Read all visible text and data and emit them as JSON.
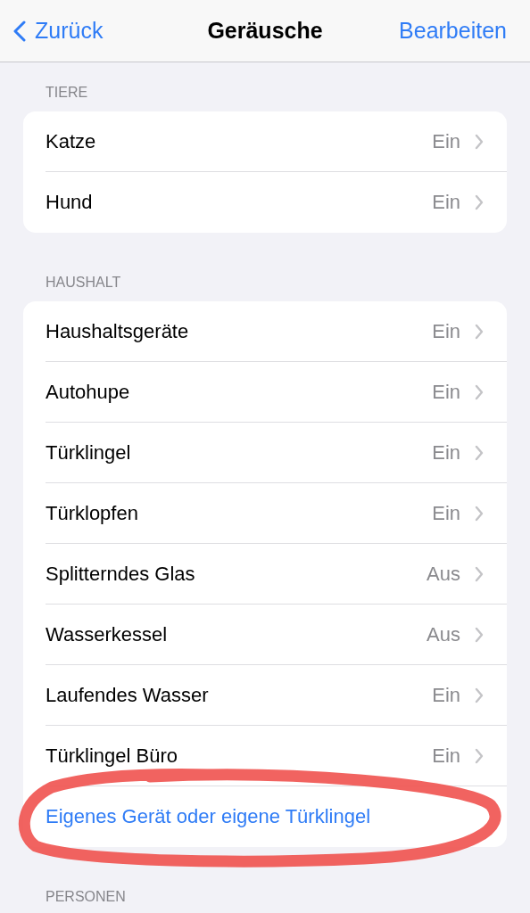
{
  "nav": {
    "back": "Zurück",
    "title": "Geräusche",
    "action": "Bearbeiten"
  },
  "sections": [
    {
      "header": "TIERE",
      "rows": [
        {
          "kind": "item",
          "label": "Katze",
          "value": "Ein"
        },
        {
          "kind": "item",
          "label": "Hund",
          "value": "Ein"
        }
      ]
    },
    {
      "header": "HAUSHALT",
      "rows": [
        {
          "kind": "item",
          "label": "Haushaltsgeräte",
          "value": "Ein"
        },
        {
          "kind": "item",
          "label": "Autohupe",
          "value": "Ein"
        },
        {
          "kind": "item",
          "label": "Türklingel",
          "value": "Ein"
        },
        {
          "kind": "item",
          "label": "Türklopfen",
          "value": "Ein"
        },
        {
          "kind": "item",
          "label": "Splitterndes Glas",
          "value": "Aus"
        },
        {
          "kind": "item",
          "label": "Wasserkessel",
          "value": "Aus"
        },
        {
          "kind": "item",
          "label": "Laufendes Wasser",
          "value": "Ein"
        },
        {
          "kind": "item",
          "label": "Türklingel Büro",
          "value": "Ein"
        },
        {
          "kind": "link",
          "label": "Eigenes Gerät oder eigene Türklingel"
        }
      ]
    },
    {
      "header": "PERSONEN"
    }
  ],
  "annotation": {
    "kind": "ellipse"
  }
}
